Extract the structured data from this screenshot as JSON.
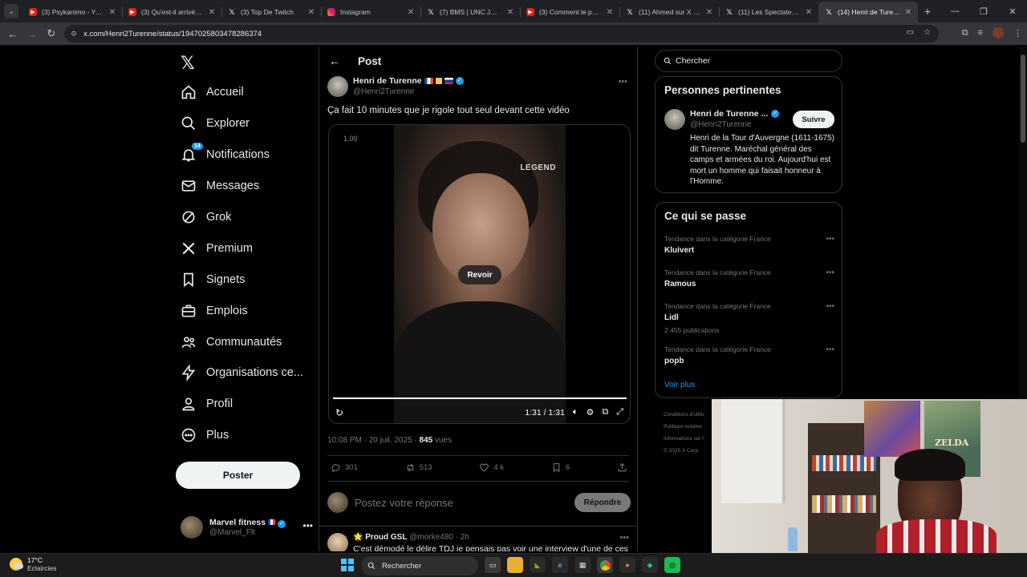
{
  "browser": {
    "tabs": [
      {
        "title": "(3) Psykanimo - YouTube",
        "favicon": "youtube-icon"
      },
      {
        "title": "(3) Qu'est-il arrivé à l'",
        "favicon": "youtube-icon"
      },
      {
        "title": "(3) Top De Twitch",
        "favicon": "x-icon"
      },
      {
        "title": "Instagram",
        "favicon": "instagram-icon"
      },
      {
        "title": "(7) BMS | UNC JOEL",
        "favicon": "x-icon"
      },
      {
        "title": "(3) Comment le peuple",
        "favicon": "youtube-icon"
      },
      {
        "title": "(11) Ahmed sur X : \"le",
        "favicon": "x-icon"
      },
      {
        "title": "(11) Les Spectateurs",
        "favicon": "x-icon"
      },
      {
        "title": "(14) Henri de Turenne",
        "favicon": "x-icon",
        "active": true
      }
    ],
    "url": "x.com/Henri2Turenne/status/1947025803478286374"
  },
  "sidebar": {
    "items": [
      {
        "label": "Accueil",
        "icon": "home-icon"
      },
      {
        "label": "Explorer",
        "icon": "search-icon"
      },
      {
        "label": "Notifications",
        "icon": "bell-icon",
        "badge": "14"
      },
      {
        "label": "Messages",
        "icon": "mail-icon"
      },
      {
        "label": "Grok",
        "icon": "grok-icon"
      },
      {
        "label": "Premium",
        "icon": "x-icon"
      },
      {
        "label": "Signets",
        "icon": "bookmark-icon"
      },
      {
        "label": "Emplois",
        "icon": "briefcase-icon"
      },
      {
        "label": "Communautés",
        "icon": "people-icon"
      },
      {
        "label": "Organisations ce...",
        "icon": "bolt-icon"
      },
      {
        "label": "Profil",
        "icon": "person-icon"
      },
      {
        "label": "Plus",
        "icon": "more-circle-icon"
      }
    ],
    "post_button": "Poster",
    "account": {
      "name": "Marvel fitness",
      "handle": "@Marvel_Flt"
    }
  },
  "post": {
    "header": "Post",
    "author_name": "Henri de Turenne",
    "author_handle": "@Henri2Turenne",
    "text": "Ça fait 10 minutes que je rigole tout seul devant cette vidéo",
    "video": {
      "speed": "1.00",
      "watermark": "LEGEND",
      "replay_label": "Revoir",
      "time": "1:31 / 1:31",
      "progress": 1.0
    },
    "meta_time": "10:08 PM · 20 juil. 2025 · ",
    "meta_views": "845",
    "meta_views_label": " vues",
    "stats": {
      "replies": "301",
      "reposts": "513",
      "likes": "4 k",
      "bookmarks": "6"
    },
    "reply_placeholder": "Postez votre réponse",
    "reply_button": "Répondre"
  },
  "comment": {
    "emoji": "🌟",
    "name": "Proud GSL",
    "handle": "@morke480",
    "time": "· 2h",
    "text": "C'est démodé le délire TDJ je pensais pas voir une interview d'une de ces"
  },
  "right": {
    "search_placeholder": "Chercher",
    "relevant_title": "Personnes pertinentes",
    "person": {
      "name": "Henri de Turenne ...",
      "handle": "@Henri2Turenne",
      "follow": "Suivre",
      "bio": "Henri de la Tour d'Auvergne (1611-1675) dit Turenne. Maréchal général des camps et armées du roi. Aujourd'hui est mort un homme qui faisait honneur à l'Homme."
    },
    "trends_title": "Ce qui se passe",
    "trends": [
      {
        "category": "Tendance dans la catégorie France",
        "name": "Kluivert",
        "count": ""
      },
      {
        "category": "Tendance dans la catégorie France",
        "name": "Ramous",
        "count": ""
      },
      {
        "category": "Tendance dans la catégorie France",
        "name": "Lidl",
        "count": "2 455 publications"
      },
      {
        "category": "Tendance dans la catégorie France",
        "name": "popb",
        "count": ""
      }
    ],
    "see_more": "Voir plus",
    "footer": [
      "Conditions d'utilis",
      "Politique relative",
      "Informations sur l",
      "© 2025 X Corp."
    ]
  },
  "webcam": {
    "poster_text": "ZELDA"
  },
  "taskbar": {
    "temperature": "17°C",
    "weather": "Eclaircies",
    "search_placeholder": "Rechercher"
  },
  "colors": {
    "accent": "#1d9bf0",
    "background": "#000000",
    "border": "#2f3336",
    "muted": "#71767b"
  }
}
